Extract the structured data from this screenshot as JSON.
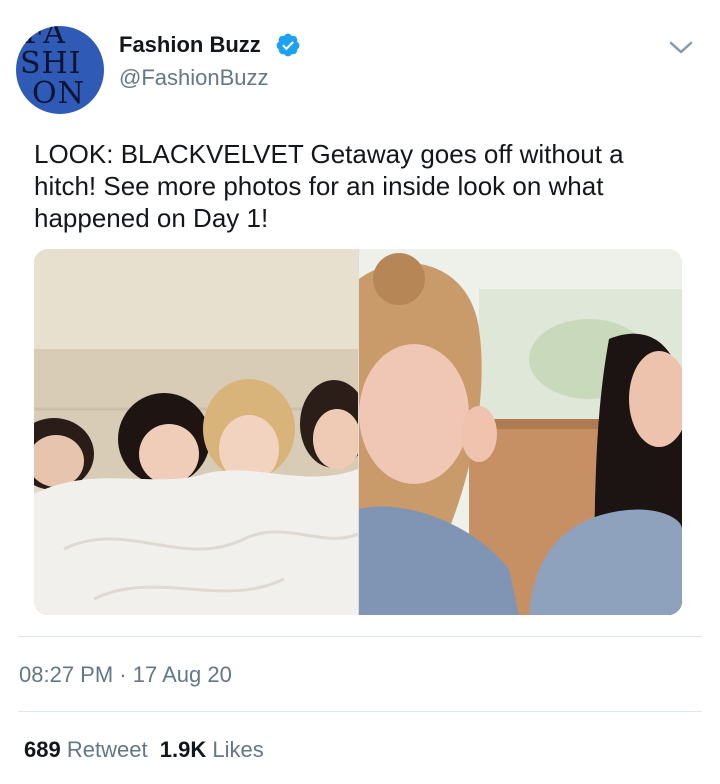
{
  "account": {
    "display_name": "Fashion Buzz",
    "handle": "@FashionBuzz",
    "avatar_logo_lines": [
      "FA",
      "SHI",
      "ON"
    ],
    "avatar_color": "#2f5bb6",
    "verified": true,
    "verified_icon": "verified-badge-icon",
    "menu_icon": "chevron-down-icon"
  },
  "tweet": {
    "text": "LOOK: BLACKVELVET Getaway goes off without a hitch! See more photos for an inside look on what happened on Day 1!",
    "timestamp": "08:27 PM · 17 Aug 20",
    "media": [
      {
        "kind": "photo",
        "subject": "four women under a white blanket"
      },
      {
        "kind": "photo",
        "subject": "two women in denim jackets"
      }
    ]
  },
  "stats": {
    "retweet_count": "689",
    "retweet_label": "Retweet",
    "like_count": "1.9K",
    "like_label": "Likes"
  },
  "colors": {
    "text_primary": "#14171a",
    "text_secondary": "#657786",
    "accent": "#1da1f2",
    "divider": "#e1e8ed"
  }
}
